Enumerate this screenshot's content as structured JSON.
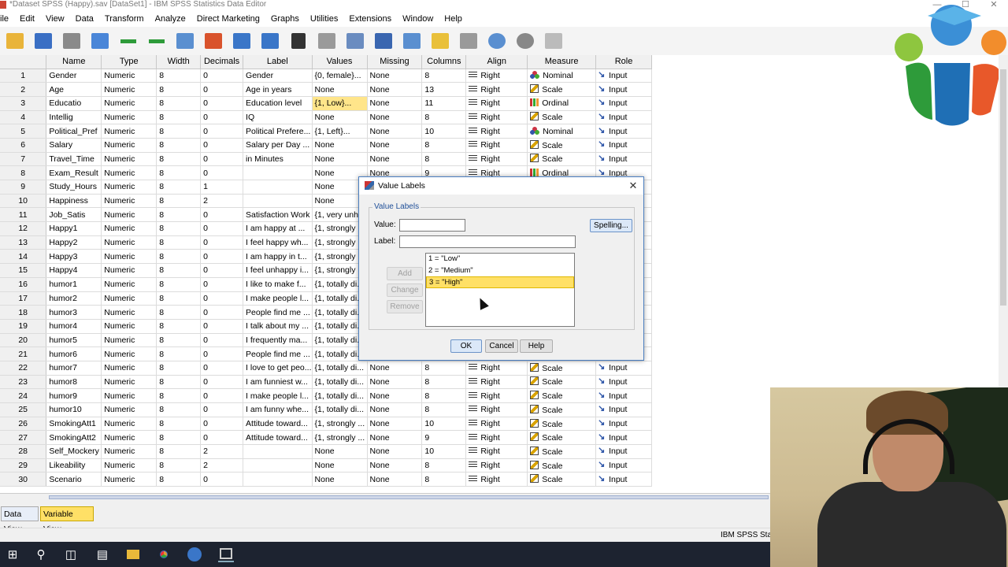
{
  "window": {
    "title": "*Dataset SPSS (Happy).sav [DataSet1] - IBM SPSS Statistics Data Editor"
  },
  "menu": [
    "ile",
    "Edit",
    "View",
    "Data",
    "Transform",
    "Analyze",
    "Direct Marketing",
    "Graphs",
    "Utilities",
    "Extensions",
    "Window",
    "Help"
  ],
  "toolbar_icons": [
    "open-icon",
    "save-icon",
    "print-icon",
    "dialog-recall-icon",
    "undo-icon",
    "redo-icon",
    "goto-case-icon",
    "goto-variable-icon",
    "variables-icon",
    "variable-list-icon",
    "find-icon",
    "insert-cases-icon",
    "insert-variable-icon",
    "split-file-icon",
    "weight-cases-icon",
    "select-cases-icon",
    "value-labels-icon",
    "use-sets-icon",
    "show-all-variables-icon",
    "spell-check-icon"
  ],
  "grid": {
    "columns": [
      "",
      "Name",
      "Type",
      "Width",
      "Decimals",
      "Label",
      "Values",
      "Missing",
      "Columns",
      "Align",
      "Measure",
      "Role"
    ],
    "rows": [
      {
        "n": "1",
        "name": "Gender",
        "type": "Numeric",
        "width": "8",
        "dec": "0",
        "label": "Gender",
        "values": "{0, female}...",
        "missing": "None",
        "cols": "8",
        "align": "Right",
        "measure": "Nominal",
        "role": "Input"
      },
      {
        "n": "2",
        "name": "Age",
        "type": "Numeric",
        "width": "8",
        "dec": "0",
        "label": "Age in years",
        "values": "None",
        "missing": "None",
        "cols": "13",
        "align": "Right",
        "measure": "Scale",
        "role": "Input"
      },
      {
        "n": "3",
        "name": "Educatio",
        "type": "Numeric",
        "width": "8",
        "dec": "0",
        "label": "Education level",
        "values": "{1, Low}...",
        "missing": "None",
        "cols": "11",
        "align": "Right",
        "measure": "Ordinal",
        "role": "Input"
      },
      {
        "n": "4",
        "name": "Intellig",
        "type": "Numeric",
        "width": "8",
        "dec": "0",
        "label": "IQ",
        "values": "None",
        "missing": "None",
        "cols": "8",
        "align": "Right",
        "measure": "Scale",
        "role": "Input"
      },
      {
        "n": "5",
        "name": "Political_Pref",
        "type": "Numeric",
        "width": "8",
        "dec": "0",
        "label": "Political Prefere...",
        "values": "{1, Left}...",
        "missing": "None",
        "cols": "10",
        "align": "Right",
        "measure": "Nominal",
        "role": "Input"
      },
      {
        "n": "6",
        "name": "Salary",
        "type": "Numeric",
        "width": "8",
        "dec": "0",
        "label": "Salary per Day ...",
        "values": "None",
        "missing": "None",
        "cols": "8",
        "align": "Right",
        "measure": "Scale",
        "role": "Input"
      },
      {
        "n": "7",
        "name": "Travel_Time",
        "type": "Numeric",
        "width": "8",
        "dec": "0",
        "label": "in Minutes",
        "values": "None",
        "missing": "None",
        "cols": "8",
        "align": "Right",
        "measure": "Scale",
        "role": "Input"
      },
      {
        "n": "8",
        "name": "Exam_Result",
        "type": "Numeric",
        "width": "8",
        "dec": "0",
        "label": "",
        "values": "None",
        "missing": "None",
        "cols": "9",
        "align": "Right",
        "measure": "Ordinal",
        "role": "Input"
      },
      {
        "n": "9",
        "name": "Study_Hours",
        "type": "Numeric",
        "width": "8",
        "dec": "1",
        "label": "",
        "values": "None",
        "missing": "",
        "cols": "",
        "align": "",
        "measure": "",
        "role": ""
      },
      {
        "n": "10",
        "name": "Happiness",
        "type": "Numeric",
        "width": "8",
        "dec": "2",
        "label": "",
        "values": "None",
        "missing": "",
        "cols": "",
        "align": "",
        "measure": "",
        "role": ""
      },
      {
        "n": "11",
        "name": "Job_Satis",
        "type": "Numeric",
        "width": "8",
        "dec": "0",
        "label": "Satisfaction Work",
        "values": "{1, very unh...",
        "missing": "",
        "cols": "",
        "align": "",
        "measure": "",
        "role": ""
      },
      {
        "n": "12",
        "name": "Happy1",
        "type": "Numeric",
        "width": "8",
        "dec": "0",
        "label": "I am happy at ...",
        "values": "{1, strongly ...",
        "missing": "",
        "cols": "",
        "align": "",
        "measure": "",
        "role": ""
      },
      {
        "n": "13",
        "name": "Happy2",
        "type": "Numeric",
        "width": "8",
        "dec": "0",
        "label": "I feel happy wh...",
        "values": "{1, strongly ...",
        "missing": "",
        "cols": "",
        "align": "",
        "measure": "",
        "role": ""
      },
      {
        "n": "14",
        "name": "Happy3",
        "type": "Numeric",
        "width": "8",
        "dec": "0",
        "label": "I am happy in t...",
        "values": "{1, strongly ...",
        "missing": "",
        "cols": "",
        "align": "",
        "measure": "",
        "role": ""
      },
      {
        "n": "15",
        "name": "Happy4",
        "type": "Numeric",
        "width": "8",
        "dec": "0",
        "label": "I feel unhappy i...",
        "values": "{1, strongly ...",
        "missing": "",
        "cols": "",
        "align": "",
        "measure": "",
        "role": ""
      },
      {
        "n": "16",
        "name": "humor1",
        "type": "Numeric",
        "width": "8",
        "dec": "0",
        "label": "I like to make f...",
        "values": "{1, totally di...",
        "missing": "",
        "cols": "",
        "align": "",
        "measure": "",
        "role": ""
      },
      {
        "n": "17",
        "name": "humor2",
        "type": "Numeric",
        "width": "8",
        "dec": "0",
        "label": "I make people l...",
        "values": "{1, totally di...",
        "missing": "",
        "cols": "",
        "align": "",
        "measure": "",
        "role": ""
      },
      {
        "n": "18",
        "name": "humor3",
        "type": "Numeric",
        "width": "8",
        "dec": "0",
        "label": "People find me ...",
        "values": "{1, totally di...",
        "missing": "",
        "cols": "",
        "align": "",
        "measure": "",
        "role": ""
      },
      {
        "n": "19",
        "name": "humor4",
        "type": "Numeric",
        "width": "8",
        "dec": "0",
        "label": "I talk about my ...",
        "values": "{1, totally di...",
        "missing": "",
        "cols": "",
        "align": "",
        "measure": "",
        "role": ""
      },
      {
        "n": "20",
        "name": "humor5",
        "type": "Numeric",
        "width": "8",
        "dec": "0",
        "label": "I frequently ma...",
        "values": "{1, totally di...",
        "missing": "",
        "cols": "",
        "align": "",
        "measure": "",
        "role": ""
      },
      {
        "n": "21",
        "name": "humor6",
        "type": "Numeric",
        "width": "8",
        "dec": "0",
        "label": "People find me ...",
        "values": "{1, totally di...",
        "missing": "",
        "cols": "",
        "align": "",
        "measure": "",
        "role": ""
      },
      {
        "n": "22",
        "name": "humor7",
        "type": "Numeric",
        "width": "8",
        "dec": "0",
        "label": "I love to get peo...",
        "values": "{1, totally di...",
        "missing": "None",
        "cols": "8",
        "align": "Right",
        "measure": "Scale",
        "role": "Input"
      },
      {
        "n": "23",
        "name": "humor8",
        "type": "Numeric",
        "width": "8",
        "dec": "0",
        "label": "I am funniest w...",
        "values": "{1, totally di...",
        "missing": "None",
        "cols": "8",
        "align": "Right",
        "measure": "Scale",
        "role": "Input"
      },
      {
        "n": "24",
        "name": "humor9",
        "type": "Numeric",
        "width": "8",
        "dec": "0",
        "label": "I make people l...",
        "values": "{1, totally di...",
        "missing": "None",
        "cols": "8",
        "align": "Right",
        "measure": "Scale",
        "role": "Input"
      },
      {
        "n": "25",
        "name": "humor10",
        "type": "Numeric",
        "width": "8",
        "dec": "0",
        "label": "I am funny whe...",
        "values": "{1, totally di...",
        "missing": "None",
        "cols": "8",
        "align": "Right",
        "measure": "Scale",
        "role": "Input"
      },
      {
        "n": "26",
        "name": "SmokingAtt1",
        "type": "Numeric",
        "width": "8",
        "dec": "0",
        "label": "Attitude toward...",
        "values": "{1, strongly ...",
        "missing": "None",
        "cols": "10",
        "align": "Right",
        "measure": "Scale",
        "role": "Input"
      },
      {
        "n": "27",
        "name": "SmokingAtt2",
        "type": "Numeric",
        "width": "8",
        "dec": "0",
        "label": "Attitude toward...",
        "values": "{1, strongly ...",
        "missing": "None",
        "cols": "9",
        "align": "Right",
        "measure": "Scale",
        "role": "Input"
      },
      {
        "n": "28",
        "name": "Self_Mockery",
        "type": "Numeric",
        "width": "8",
        "dec": "2",
        "label": "",
        "values": "None",
        "missing": "None",
        "cols": "10",
        "align": "Right",
        "measure": "Scale",
        "role": "Input"
      },
      {
        "n": "29",
        "name": "Likeability",
        "type": "Numeric",
        "width": "8",
        "dec": "2",
        "label": "",
        "values": "None",
        "missing": "None",
        "cols": "8",
        "align": "Right",
        "measure": "Scale",
        "role": "Input"
      },
      {
        "n": "30",
        "name": "Scenario",
        "type": "Numeric",
        "width": "8",
        "dec": "0",
        "label": "",
        "values": "None",
        "missing": "None",
        "cols": "8",
        "align": "Right",
        "measure": "Scale",
        "role": "Input"
      }
    ],
    "highlight_row": "3"
  },
  "tabs": {
    "data_view": "Data View",
    "variable_view": "Variable View"
  },
  "status": {
    "text": "IBM SPSS Sta"
  },
  "dialog": {
    "title": "Value Labels",
    "group_label": "Value Labels",
    "value_label": "Value:",
    "label_label": "Label:",
    "value_field": "",
    "label_field": "",
    "spelling_button": "Spelling...",
    "add_button": "Add",
    "change_button": "Change",
    "remove_button": "Remove",
    "items": [
      "1 = \"Low\"",
      "2 = \"Medium\"",
      "3 = \"High\""
    ],
    "selected_item": 2,
    "ok_button": "OK",
    "cancel_button": "Cancel",
    "help_button": "Help"
  },
  "colors": {
    "header_bg": "#f0f0f0",
    "highlight": "#ffe58a",
    "selected_tab": "#ffe066",
    "dialog_accent": "#1f4f98",
    "taskbar": "#1d2330"
  }
}
